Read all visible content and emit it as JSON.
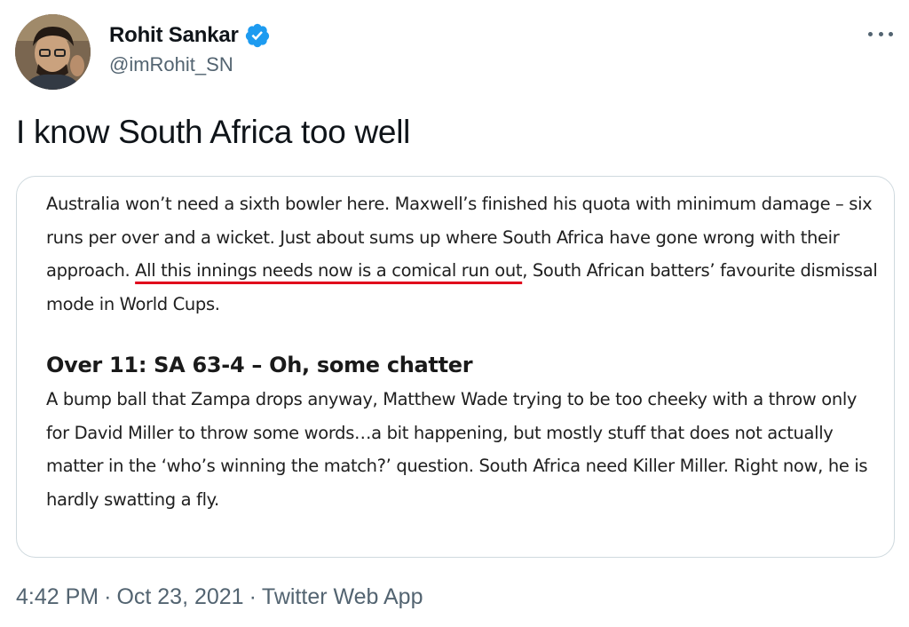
{
  "author": {
    "name": "Rohit Sankar",
    "handle": "@imRohit_SN",
    "verified": true,
    "verified_color": "#1d9bf0"
  },
  "more_icon": "more-horizontal-icon",
  "tweet": {
    "text": "I know South Africa too well"
  },
  "media": {
    "paragraph1_before": "Australia won’t need a sixth bowler here. Maxwell’s finished his quota with minimum damage – six runs per over and a wicket. Just about sums up where South Africa have gone wrong with their approach. ",
    "paragraph1_highlight": "All this innings needs now is a comical run out",
    "paragraph1_after": ", South African batters’ favourite dismissal mode in World Cups.",
    "subheading": "Over 11: SA 63-4 – Oh, some chatter",
    "paragraph2": "A bump ball that Zampa drops anyway, Matthew Wade trying to be too cheeky with a throw only for David Miller to throw some words…a bit happening, but mostly stuff that does not actually matter in the ‘who’s winning the match?’ question. South Africa need Killer Miller. Right now, he is hardly swatting a fly.",
    "highlight_color": "#e0001b"
  },
  "meta": {
    "time": "4:42 PM",
    "separator": "·",
    "date": "Oct 23, 2021",
    "source": "Twitter Web App"
  }
}
